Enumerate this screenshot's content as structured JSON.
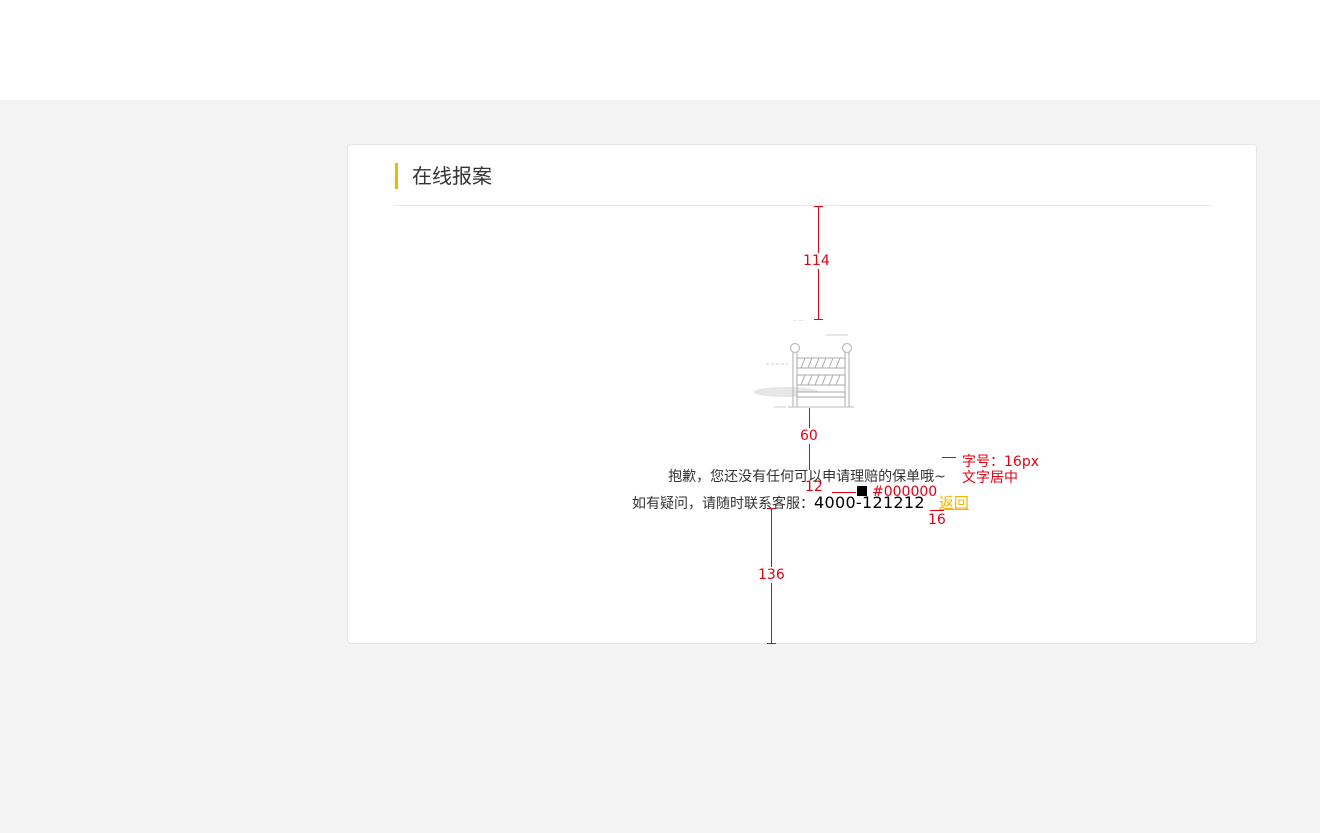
{
  "card": {
    "title": "在线报案"
  },
  "empty_state": {
    "illustration_icon": "road-barrier-icon",
    "message": "抱歉，您还没有任何可以申请理赔的保单哦~",
    "contact_prefix": "如有疑问，请随时联系客服：",
    "contact_phone": "4000-121212",
    "back_label": "返回"
  },
  "annotations": {
    "gap_top": "114",
    "gap_image_text": "60",
    "gap_lines": "12",
    "gap_link": "16",
    "gap_bottom": "136",
    "font_size_note": "字号：16px",
    "align_note": "文字居中",
    "phone_color": "#000000"
  },
  "colors": {
    "accent": "#f5b400",
    "annotation": "#e60012",
    "page_bg": "#f3f3f3"
  }
}
